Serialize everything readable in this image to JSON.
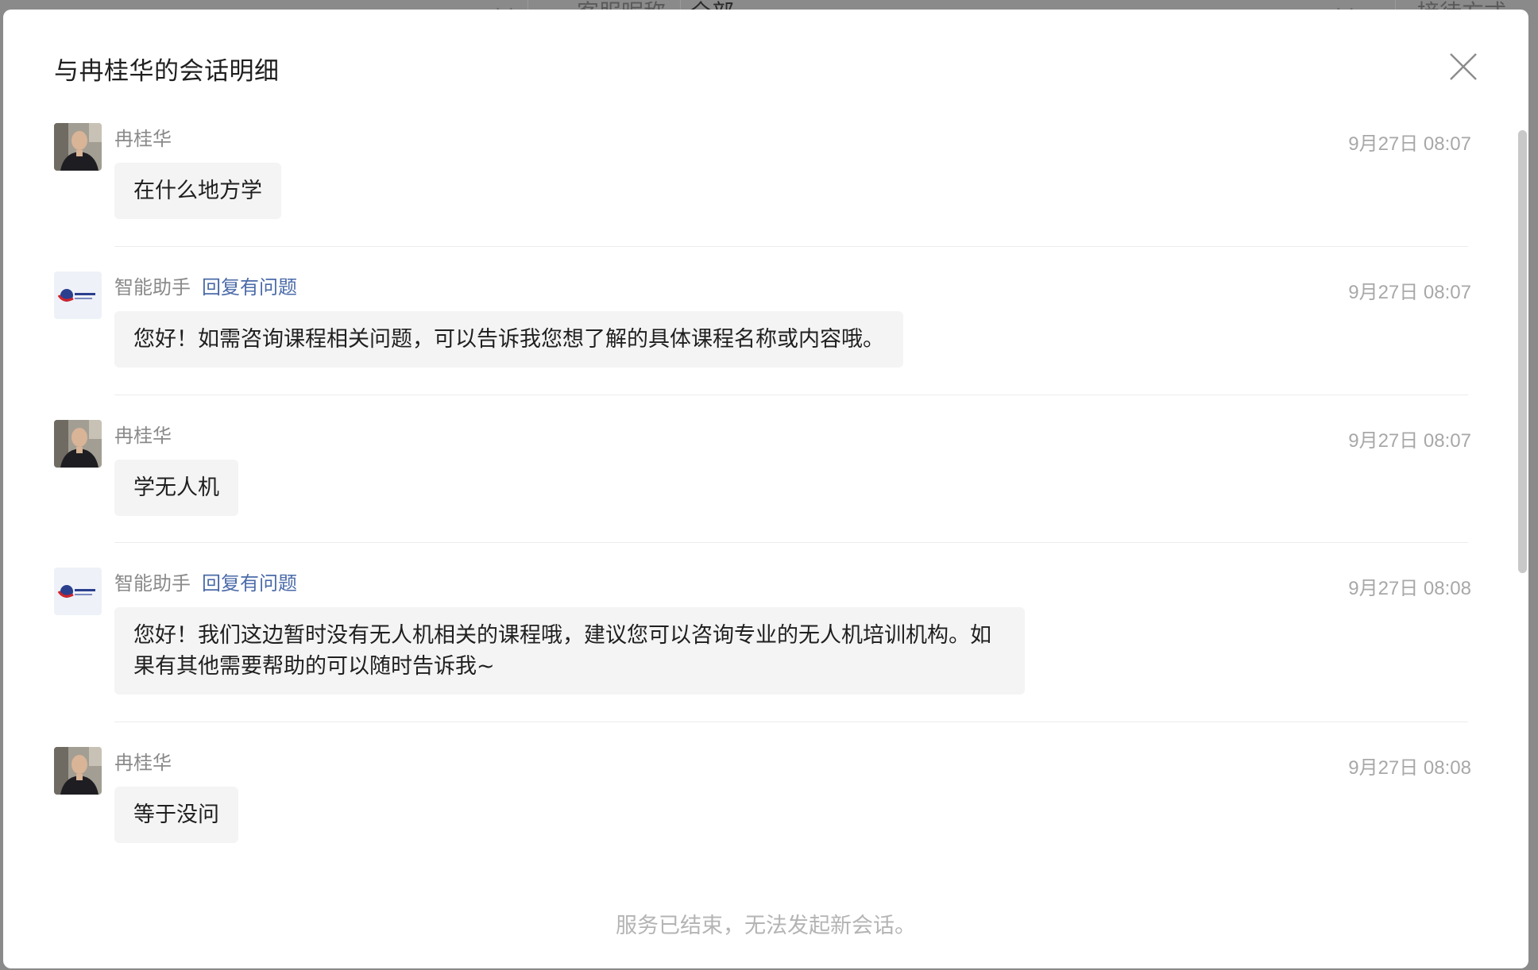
{
  "background": {
    "filter_label_a": "客服昵称",
    "filter_value_a": "全部",
    "filter_label_b": "接待方式"
  },
  "modal": {
    "title": "与冉桂华的会话明细",
    "close_icon": "close-icon",
    "footer_note": "服务已结束，无法发起新会话。"
  },
  "messages": [
    {
      "sender": "冉桂华",
      "avatar": "user-avatar",
      "flag": "",
      "time": "9月27日 08:07",
      "text": "在什么地方学"
    },
    {
      "sender": "智能助手",
      "avatar": "assistant-avatar",
      "flag": "回复有问题",
      "time": "9月27日 08:07",
      "text": "您好！如需咨询课程相关问题，可以告诉我您想了解的具体课程名称或内容哦。"
    },
    {
      "sender": "冉桂华",
      "avatar": "user-avatar",
      "flag": "",
      "time": "9月27日 08:07",
      "text": "学无人机"
    },
    {
      "sender": "智能助手",
      "avatar": "assistant-avatar",
      "flag": "回复有问题",
      "time": "9月27日 08:08",
      "text": "您好！我们这边暂时没有无人机相关的课程哦，建议您可以咨询专业的无人机培训机构。如果有其他需要帮助的可以随时告诉我~"
    },
    {
      "sender": "冉桂华",
      "avatar": "user-avatar",
      "flag": "",
      "time": "9月27日 08:08",
      "text": "等于没问"
    }
  ],
  "colors": {
    "overlay": "#8a8a8a",
    "bubble": "#f4f4f4",
    "flag_link": "#4a6aa8",
    "muted": "#a8a8a8"
  }
}
